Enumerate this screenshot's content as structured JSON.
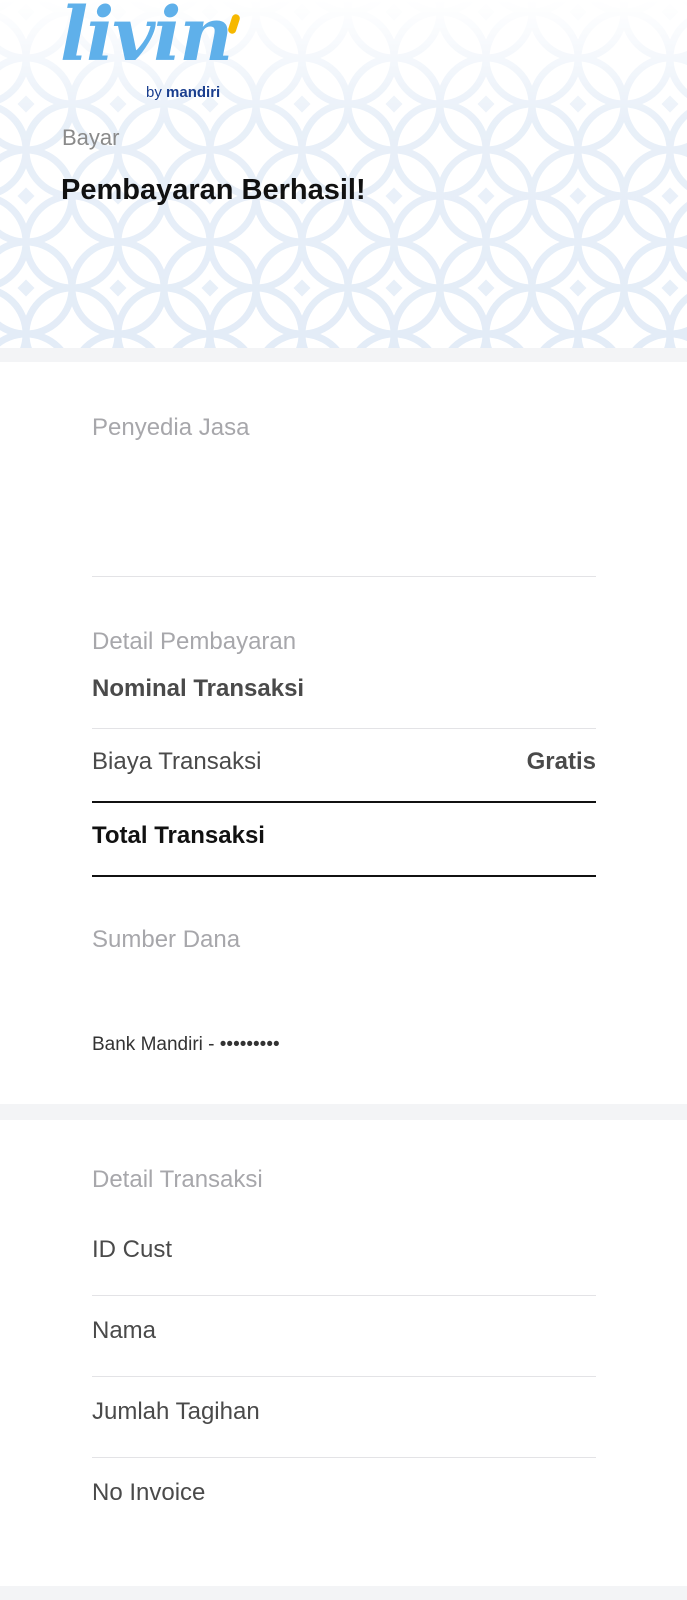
{
  "logo": {
    "word": "livin",
    "by": "by",
    "brand": "mandiri"
  },
  "header": {
    "breadcrumb": "Bayar",
    "title": "Pembayaran Berhasil!"
  },
  "provider": {
    "section_label": "Penyedia Jasa"
  },
  "payment_detail": {
    "section_label": "Detail Pembayaran",
    "nominal_label": "Nominal Transaksi",
    "fee_label": "Biaya Transaksi",
    "fee_value": "Gratis",
    "total_label": "Total Transaksi"
  },
  "funding": {
    "section_label": "Sumber Dana",
    "account": "Bank Mandiri - •••••••••"
  },
  "transaction_detail": {
    "section_label": "Detail Transaksi",
    "rows": [
      "ID Cust",
      "Nama",
      "Jumlah Tagihan",
      "No Invoice"
    ]
  },
  "colors": {
    "brand_blue": "#5fb0ea",
    "brand_yellow": "#f6b800",
    "brand_navy": "#1b3f8f"
  }
}
